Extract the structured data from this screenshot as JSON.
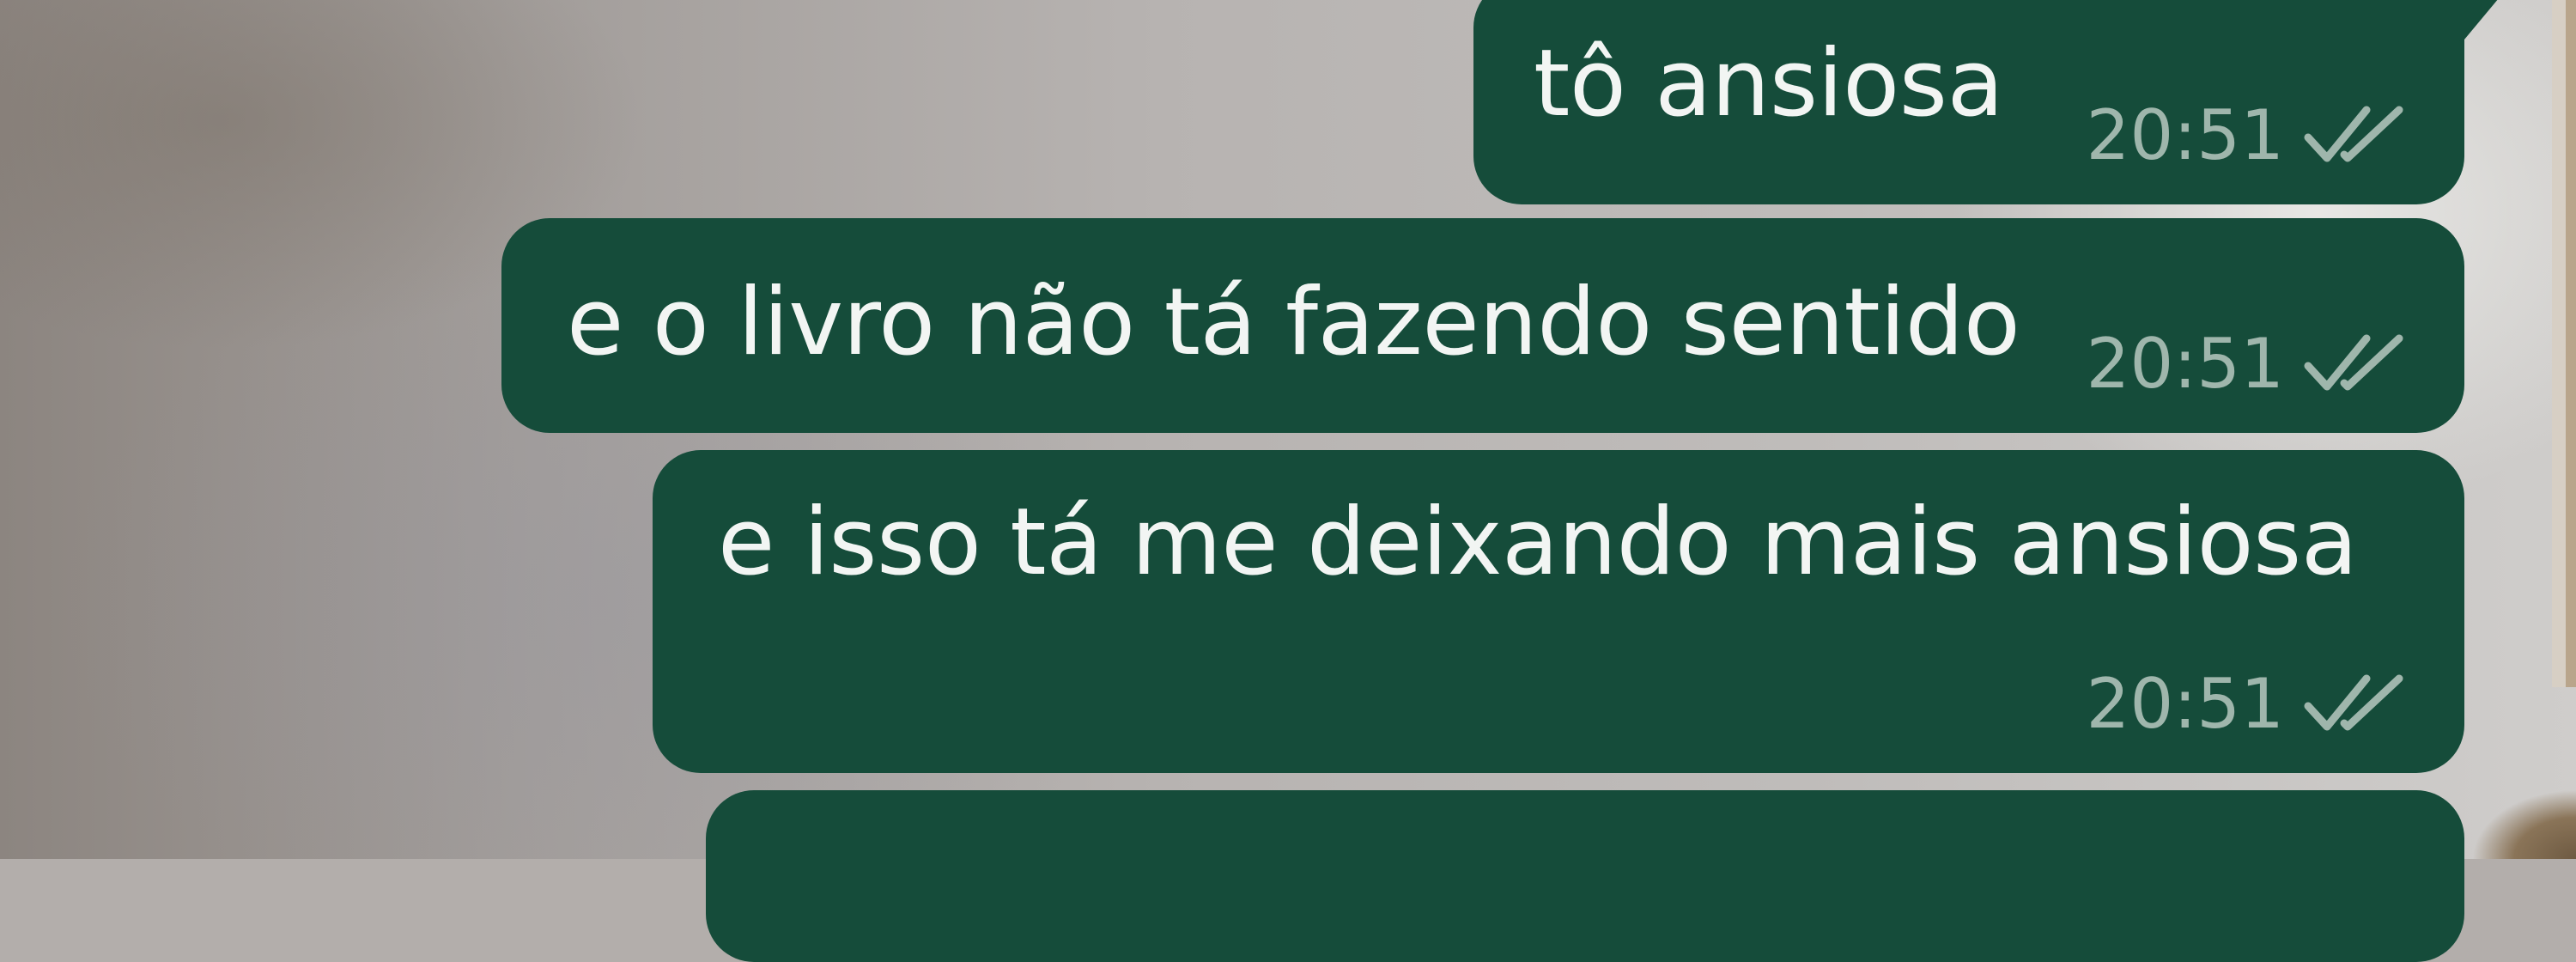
{
  "chat": {
    "messages": [
      {
        "text": "tô ansiosa",
        "time": "20:51",
        "status": "read",
        "status_icon": "double-check-icon"
      },
      {
        "text": "e o livro não tá fazendo sentido",
        "time": "20:51",
        "status": "read",
        "status_icon": "double-check-icon"
      },
      {
        "text": "e isso tá me deixando mais ansiosa",
        "time": "20:51",
        "status": "read",
        "status_icon": "double-check-icon"
      },
      {
        "text": "",
        "time": "",
        "status": "",
        "status_icon": ""
      }
    ]
  },
  "colors": {
    "outgoing_bubble": "#154c3a",
    "message_text": "#f2f5f3",
    "timestamp_text": "#9fb6ac",
    "read_ticks": "#9fb6ac"
  }
}
